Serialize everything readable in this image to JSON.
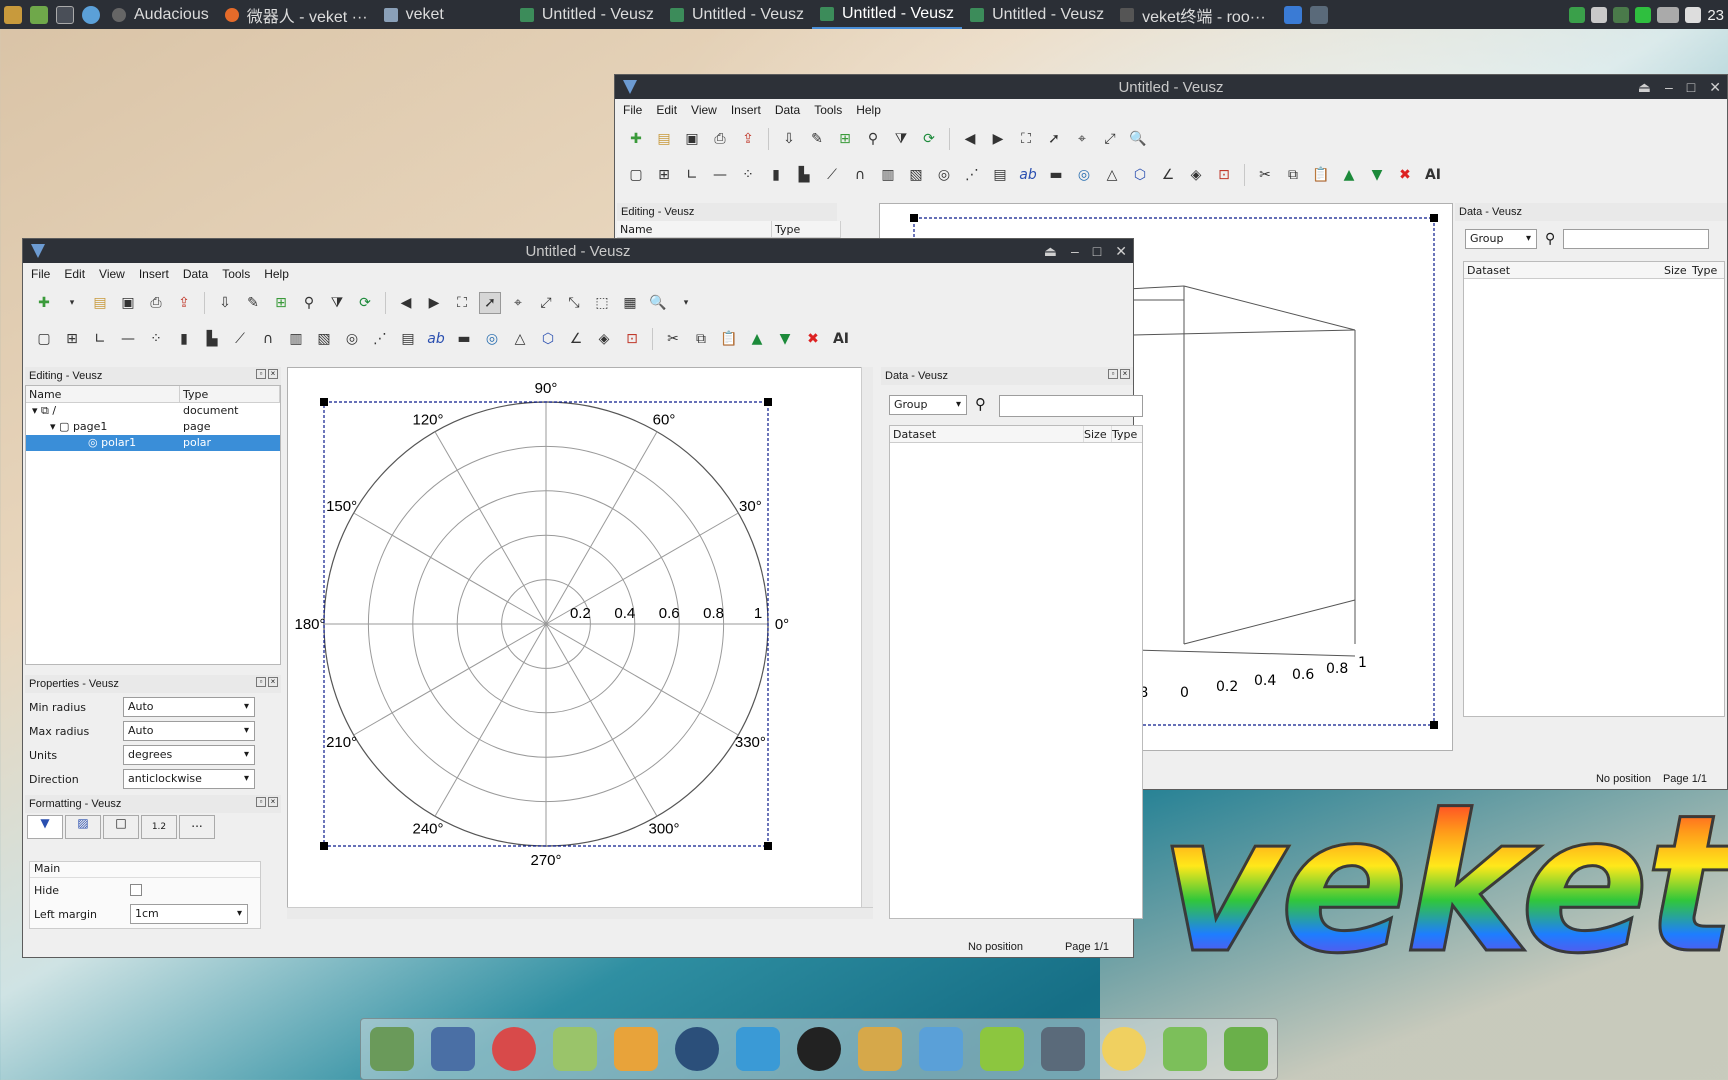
{
  "taskbar": {
    "tasks": [
      {
        "label": "Audacious"
      },
      {
        "label": "微器人 - veket ···"
      },
      {
        "label": "veket"
      },
      {
        "label": "Untitled - Veusz"
      },
      {
        "label": "Untitled - Veusz"
      },
      {
        "label": "Untitled - Veusz"
      },
      {
        "label": "Untitled - Veusz"
      },
      {
        "label": "veket终端 - roo···"
      }
    ],
    "clock": "23"
  },
  "bg_window": {
    "title": "Untitled - Veusz",
    "menu": [
      "File",
      "Edit",
      "View",
      "Insert",
      "Data",
      "Tools",
      "Help"
    ],
    "editing_title": "Editing - Veusz",
    "col_name": "Name",
    "col_type": "Type",
    "axis_ticks": [
      "0.8",
      "0",
      "0.2",
      "0.4",
      "0.6",
      "0.8",
      "1"
    ],
    "data_title": "Data - Veusz",
    "group_label": "Group",
    "dataset_col": "Dataset",
    "size_col": "Size",
    "type_col": "Type",
    "status_pos": "No position",
    "status_page": "Page 1/1"
  },
  "main_window": {
    "title": "Untitled - Veusz",
    "menu": [
      "File",
      "Edit",
      "View",
      "Insert",
      "Data",
      "Tools",
      "Help"
    ],
    "editing": {
      "title": "Editing - Veusz",
      "col_name": "Name",
      "col_type": "Type",
      "rows": [
        {
          "name": "/",
          "type": "document"
        },
        {
          "name": "page1",
          "type": "page"
        },
        {
          "name": "polar1",
          "type": "polar"
        }
      ]
    },
    "properties": {
      "title": "Properties - Veusz",
      "rows": [
        {
          "label": "Min radius",
          "value": "Auto"
        },
        {
          "label": "Max radius",
          "value": "Auto"
        },
        {
          "label": "Units",
          "value": "degrees"
        },
        {
          "label": "Direction",
          "value": "anticlockwise"
        }
      ]
    },
    "formatting": {
      "title": "Formatting - Veusz",
      "tab_num": "1.2",
      "tab_dots": "...",
      "section": "Main",
      "hide_label": "Hide",
      "left_margin_label": "Left margin",
      "left_margin_value": "1cm"
    },
    "polar": {
      "angle_labels": [
        "0°",
        "30°",
        "60°",
        "90°",
        "120°",
        "150°",
        "180°",
        "210°",
        "240°",
        "270°",
        "300°",
        "330°"
      ],
      "radial_labels": [
        "0.2",
        "0.4",
        "0.6",
        "0.8",
        "1"
      ]
    },
    "data_panel": {
      "title": "Data - Veusz",
      "group_label": "Group",
      "search_placeholder": "",
      "dataset_col": "Dataset",
      "size_col": "Size",
      "type_col": "Type"
    },
    "status_pos": "No position",
    "status_page": "Page 1/1"
  },
  "desktop": {
    "logo_text": "veket"
  }
}
